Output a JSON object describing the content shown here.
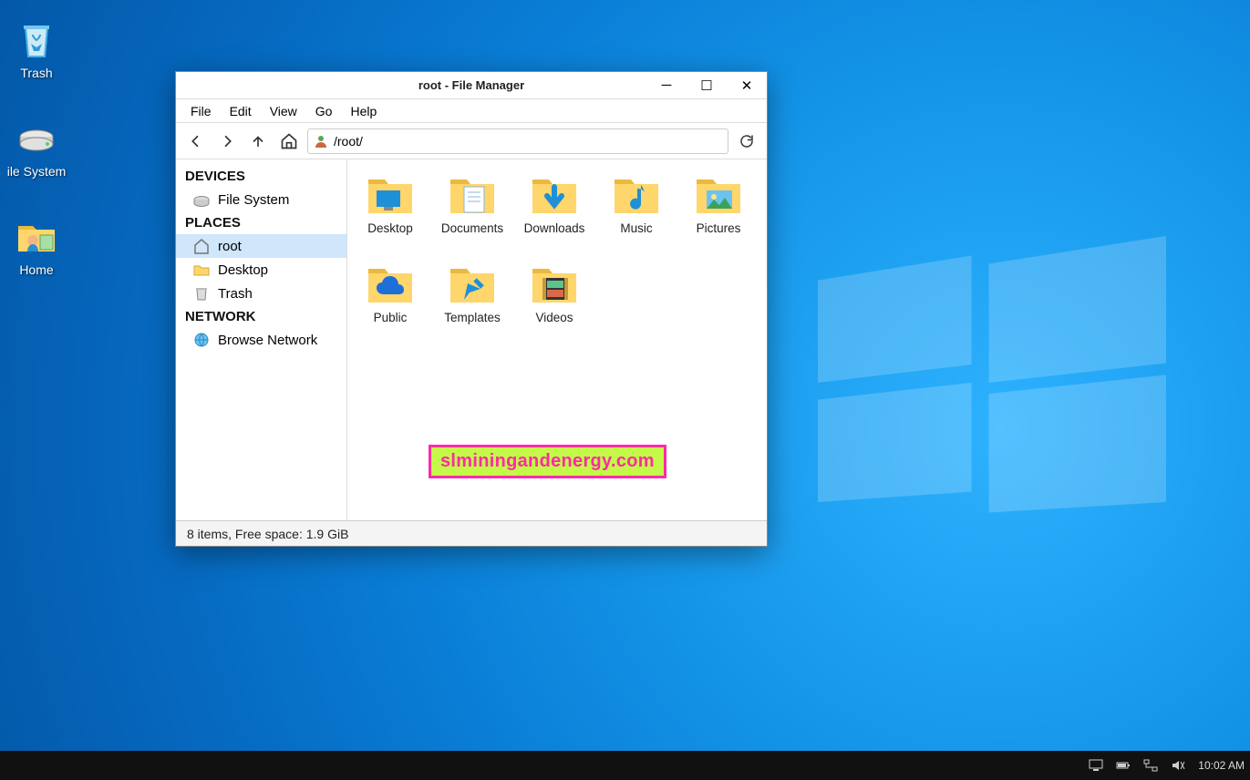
{
  "desktop": {
    "icons": [
      {
        "name": "trash",
        "label": "Trash"
      },
      {
        "name": "filesystem",
        "label": "ile System"
      },
      {
        "name": "home",
        "label": "Home"
      }
    ]
  },
  "window": {
    "title": "root - File Manager",
    "menu": [
      "File",
      "Edit",
      "View",
      "Go",
      "Help"
    ],
    "path": "/root/",
    "sidebar": {
      "sections": [
        {
          "title": "DEVICES",
          "items": [
            {
              "name": "filesystem",
              "label": "File System"
            }
          ]
        },
        {
          "title": "PLACES",
          "items": [
            {
              "name": "root",
              "label": "root",
              "active": true
            },
            {
              "name": "desktop",
              "label": "Desktop"
            },
            {
              "name": "trash",
              "label": "Trash"
            }
          ]
        },
        {
          "title": "NETWORK",
          "items": [
            {
              "name": "browse-network",
              "label": "Browse Network"
            }
          ]
        }
      ]
    },
    "folders": [
      {
        "name": "desktop",
        "label": "Desktop",
        "overlay": "monitor"
      },
      {
        "name": "documents",
        "label": "Documents",
        "overlay": "doc"
      },
      {
        "name": "downloads",
        "label": "Downloads",
        "overlay": "arrow-down"
      },
      {
        "name": "music",
        "label": "Music",
        "overlay": "note"
      },
      {
        "name": "pictures",
        "label": "Pictures",
        "overlay": "photo"
      },
      {
        "name": "public",
        "label": "Public",
        "overlay": "cloud"
      },
      {
        "name": "templates",
        "label": "Templates",
        "overlay": "shortcut"
      },
      {
        "name": "videos",
        "label": "Videos",
        "overlay": "film"
      }
    ],
    "status": "8 items, Free space: 1.9 GiB"
  },
  "taskbar": {
    "clock": "10:02 AM"
  },
  "watermark": "slminingandenergy.com"
}
